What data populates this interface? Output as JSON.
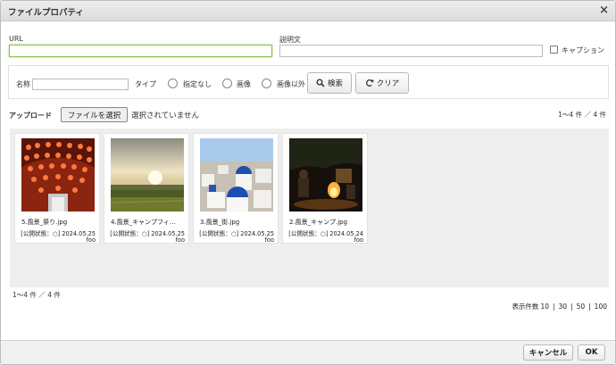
{
  "dialog": {
    "title": "ファイルプロパティ",
    "close_symbol": "×"
  },
  "url": {
    "label": "URL",
    "value": ""
  },
  "description": {
    "label": "説明文",
    "value": ""
  },
  "caption": {
    "label": "キャプション",
    "checked": false
  },
  "search": {
    "name_label": "名称",
    "name_value": "",
    "type_label": "タイプ",
    "types": [
      "指定なし",
      "画像",
      "画像以外"
    ],
    "search_button": "検索",
    "clear_button": "クリア"
  },
  "upload": {
    "label": "アップロード",
    "choose_button": "ファイルを選択",
    "status": "選択されていません"
  },
  "count_top": "1〜4 件 ／ 4 件",
  "count_bottom": "1〜4 件 ／ 4 件",
  "files": [
    {
      "name": "5.風景_祭り.jpg",
      "meta": "[公開状態：○] 2024.05.25",
      "owner": "foo",
      "thumb": "festival-lanterns"
    },
    {
      "name": "4.風景_キャンプフィ…",
      "meta": "[公開状態：○] 2024.05.25",
      "owner": "foo",
      "thumb": "sunset-field"
    },
    {
      "name": "3.風景_街.jpg",
      "meta": "[公開状態：○] 2024.05.25",
      "owner": "foo",
      "thumb": "white-town-blue-domes"
    },
    {
      "name": "2.風景_キャンプ.jpg",
      "meta": "[公開状態：○] 2024.05.24",
      "owner": "foo",
      "thumb": "campfire-night"
    }
  ],
  "per_page": {
    "label": "表示件数",
    "options": [
      "10",
      "30",
      "50",
      "100"
    ],
    "separator": "|"
  },
  "footer": {
    "cancel": "キャンセル",
    "ok": "OK"
  }
}
